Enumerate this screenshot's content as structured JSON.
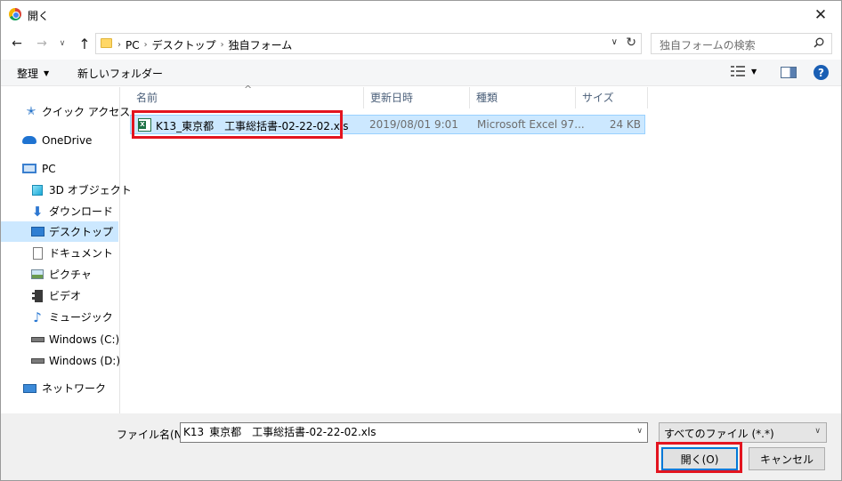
{
  "window": {
    "title": "開く",
    "close_glyph": "✕"
  },
  "nav": {
    "back_glyph": "←",
    "forward_glyph": "→",
    "recent_glyph": "∨",
    "up_glyph": "↑",
    "breadcrumbs": [
      "PC",
      "デスクトップ",
      "独自フォーム"
    ],
    "crumb_separator": "›",
    "address_dropdown_glyph": "∨",
    "refresh_glyph": "↻",
    "search_placeholder": "独自フォームの検索"
  },
  "toolbar": {
    "organize_label": "整理",
    "organize_dropdown": "▼",
    "new_folder_label": "新しいフォルダー",
    "view_dropdown": "▼",
    "help_label": "?"
  },
  "sidebar": {
    "items": [
      {
        "label": "クイック アクセス",
        "icon": "star-icon"
      },
      {
        "label": "OneDrive",
        "icon": "cloud-icon"
      },
      {
        "label": "PC",
        "icon": "pc-icon"
      },
      {
        "label": "3D オブジェクト",
        "icon": "cube-icon"
      },
      {
        "label": "ダウンロード",
        "icon": "download-icon"
      },
      {
        "label": "デスクトップ",
        "icon": "desktop-icon",
        "selected": true
      },
      {
        "label": "ドキュメント",
        "icon": "document-icon"
      },
      {
        "label": "ピクチャ",
        "icon": "picture-icon"
      },
      {
        "label": "ビデオ",
        "icon": "video-icon"
      },
      {
        "label": "ミュージック",
        "icon": "music-icon"
      },
      {
        "label": "Windows  (C:)",
        "icon": "drive-icon"
      },
      {
        "label": "Windows (D:)",
        "icon": "drive-icon"
      },
      {
        "label": "ネットワーク",
        "icon": "network-icon"
      }
    ],
    "star_glyph": "✭",
    "download_glyph": "⬇",
    "music_glyph": "♪"
  },
  "filelist": {
    "sort_glyph": "^",
    "columns": [
      "名前",
      "更新日時",
      "種類",
      "サイズ"
    ],
    "rows": [
      {
        "name": "K13_東京都　工事総括書-02-22-02.xls",
        "modified": "2019/08/01 9:01",
        "type": "Microsoft Excel 97...",
        "size": "24 KB",
        "icon": "excel-file-icon",
        "selected": true
      }
    ]
  },
  "bottom": {
    "filename_label": "ファイル名(N):",
    "filename_value": "K13_東京都　工事総括書-02-22-02.xls",
    "filename_dropdown": "∨",
    "filter_value": "すべてのファイル (*.*)",
    "filter_dropdown": "∨",
    "open_label": "開く(O)",
    "cancel_label": "キャンセル"
  },
  "colors": {
    "selection": "#cce8ff",
    "highlight_box": "#e3141f",
    "accent": "#0078d7"
  }
}
